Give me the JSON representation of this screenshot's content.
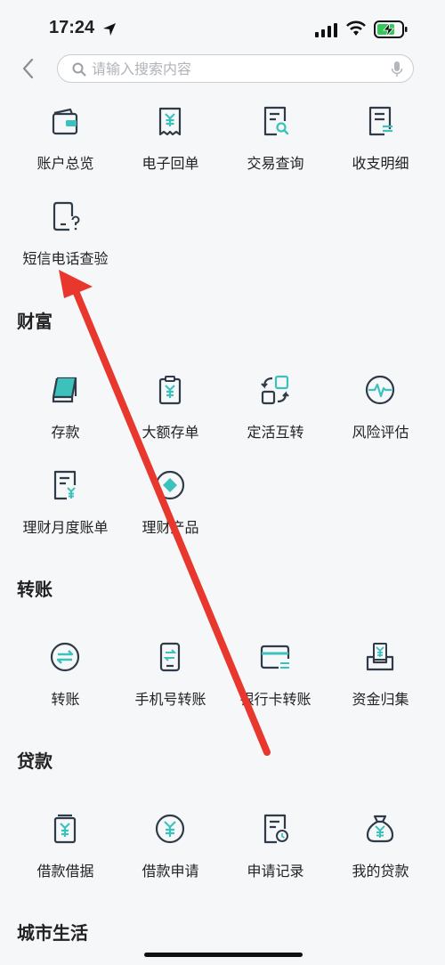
{
  "status_bar": {
    "time": "17:24"
  },
  "search": {
    "placeholder": "请输入搜索内容"
  },
  "account": [
    {
      "label": "账户总览",
      "icon": "wallet-icon"
    },
    {
      "label": "电子回单",
      "icon": "receipt-icon"
    },
    {
      "label": "交易查询",
      "icon": "document-search-icon"
    },
    {
      "label": "收支明细",
      "icon": "document-list-icon"
    },
    {
      "label": "短信电话查验",
      "icon": "phone-question-icon"
    }
  ],
  "wealth": {
    "title": "财富",
    "items": [
      {
        "label": "存款",
        "icon": "deposit-book-icon"
      },
      {
        "label": "大额存单",
        "icon": "clipboard-yuan-icon"
      },
      {
        "label": "定活互转",
        "icon": "exchange-icon"
      },
      {
        "label": "风险评估",
        "icon": "pulse-icon"
      },
      {
        "label": "理财月度账单",
        "icon": "bill-yuan-icon"
      },
      {
        "label": "理财产品",
        "icon": "diamond-icon"
      }
    ]
  },
  "transfer": {
    "title": "转账",
    "items": [
      {
        "label": "转账",
        "icon": "transfer-icon"
      },
      {
        "label": "手机号转账",
        "icon": "mobile-transfer-icon"
      },
      {
        "label": "银行卡转账",
        "icon": "bank-card-icon"
      },
      {
        "label": "资金归集",
        "icon": "fund-collect-icon"
      }
    ]
  },
  "loan": {
    "title": "贷款",
    "items": [
      {
        "label": "借款借据",
        "icon": "loan-note-icon"
      },
      {
        "label": "借款申请",
        "icon": "yuan-circle-icon"
      },
      {
        "label": "申请记录",
        "icon": "record-clock-icon"
      },
      {
        "label": "我的贷款",
        "icon": "money-bag-icon"
      }
    ]
  },
  "city": {
    "title": "城市生活"
  },
  "colors": {
    "icon_dark": "#2f3b48",
    "icon_accent": "#3cc1bd",
    "annotation_arrow": "#e8372d"
  }
}
